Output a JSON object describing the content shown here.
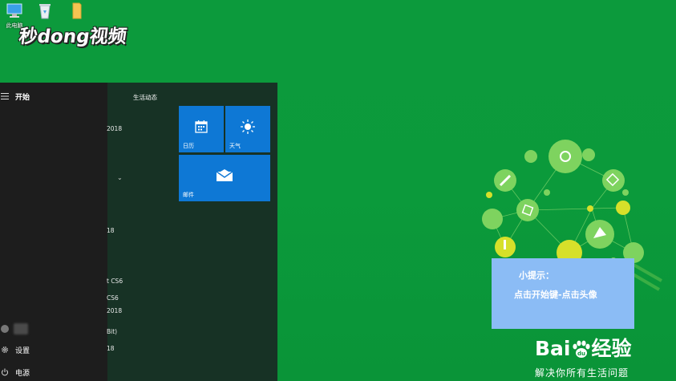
{
  "desktop": {
    "icons": [
      {
        "label": "此电脑",
        "icon": "computer-icon"
      },
      {
        "label": "",
        "icon": "recycle-bin-icon"
      },
      {
        "label": "",
        "icon": "folder-icon"
      }
    ],
    "watermark": "秒dong视频"
  },
  "start_menu": {
    "title": "开始",
    "group_title": "生活动态",
    "app_fragments": [
      "2018",
      "18",
      "t CS6",
      "CS6",
      "2018",
      "Bit)",
      "18"
    ],
    "settings_label": "设置",
    "power_label": "电源",
    "tiles": [
      {
        "label": "日历",
        "icon": "calendar-icon"
      },
      {
        "label": "天气",
        "icon": "weather-sun-icon"
      },
      {
        "label": "邮件",
        "icon": "mail-icon"
      }
    ]
  },
  "tip": {
    "title": "小提示：",
    "body": "点击开始键-点击头像"
  },
  "branding": {
    "logo_left": "Bai",
    "logo_right": "经验",
    "slogan": "解决你所有生活问题"
  },
  "colors": {
    "desktop_bg": "#0b9a3b",
    "tile_blue": "#0e78d5",
    "tip_box": "#8bbcf5",
    "menu_rail": "#1d1d1d",
    "menu_bg": "#173225"
  }
}
